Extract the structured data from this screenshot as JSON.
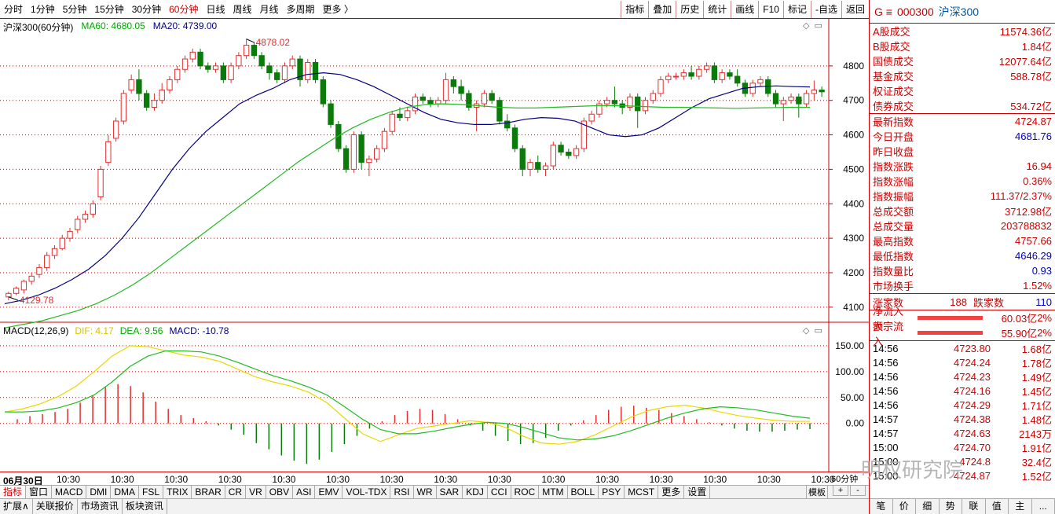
{
  "toolbar": {
    "periods": [
      "分时",
      "1分钟",
      "5分钟",
      "15分钟",
      "30分钟",
      "60分钟",
      "日线",
      "周线",
      "月线",
      "多周期",
      "更多 〉"
    ],
    "active_period": "60分钟",
    "buttons": [
      "指标",
      "叠加",
      "历史",
      "统计",
      "画线",
      "F10",
      "标记",
      "-自选",
      "返回"
    ]
  },
  "legend": {
    "name": "沪深300(60分钟)",
    "ma60": "MA60: 4680.05",
    "ma20": "MA20: 4739.00"
  },
  "macd_legend": {
    "name": "MACD(12,26,9)",
    "dif": "DIF: 4.17",
    "dea": "DEA: 9.56",
    "macd": "MACD: -10.78"
  },
  "annotations": {
    "high": "4878.02",
    "low": "4129.78"
  },
  "y_axis_main": [
    "4800",
    "4700",
    "4600",
    "4500",
    "4400",
    "4300",
    "4200",
    "4100"
  ],
  "y_axis_macd": [
    "150.00",
    "100.00",
    "50.00",
    "0.00"
  ],
  "x_axis": [
    "06月30日",
    "10:30",
    "10:30",
    "10:30",
    "10:30",
    "10:30",
    "10:30",
    "10:30",
    "10:30",
    "10:30",
    "10:30",
    "10:30",
    "10:30",
    "10:30",
    "10:30",
    "10:30"
  ],
  "period_tag": "60分钟",
  "indicator_tabs": [
    "指标",
    "窗口",
    "MACD",
    "DMI",
    "DMA",
    "FSL",
    "TRIX",
    "BRAR",
    "CR",
    "VR",
    "OBV",
    "ASI",
    "EMV",
    "VOL-TDX",
    "RSI",
    "WR",
    "SAR",
    "KDJ",
    "CCI",
    "ROC",
    "MTM",
    "BOLL",
    "PSY",
    "MCST",
    "更多",
    "设置"
  ],
  "bottom_tabs": [
    "扩展∧",
    "关联报价",
    "市场资讯",
    "板块资讯"
  ],
  "board_label": "模板",
  "side": {
    "code": "000300",
    "name": "沪深300",
    "prefix": "G ≡",
    "turnover": [
      {
        "k": "A股成交",
        "v": "11574.36亿"
      },
      {
        "k": "B股成交",
        "v": "1.84亿"
      },
      {
        "k": "国债成交",
        "v": "12077.64亿"
      },
      {
        "k": "基金成交",
        "v": "588.78亿"
      },
      {
        "k": "权证成交",
        "v": ""
      },
      {
        "k": "债券成交",
        "v": "534.72亿"
      }
    ],
    "stats": [
      {
        "k": "最新指数",
        "v": "4724.87",
        "c": "red"
      },
      {
        "k": "今日开盘",
        "v": "4681.76",
        "c": "blue"
      },
      {
        "k": "昨日收盘",
        "v": "",
        "c": "black"
      },
      {
        "k": "指数涨跌",
        "v": "16.94",
        "c": "red"
      },
      {
        "k": "指数涨幅",
        "v": "0.36%",
        "c": "red"
      },
      {
        "k": "指数振幅",
        "v": "111.37/2.37%",
        "c": "red"
      },
      {
        "k": "总成交额",
        "v": "3712.98亿",
        "c": "red"
      },
      {
        "k": "总成交量",
        "v": "203788832",
        "c": "red"
      },
      {
        "k": "最高指数",
        "v": "4757.66",
        "c": "red"
      },
      {
        "k": "最低指数",
        "v": "4646.29",
        "c": "blue"
      },
      {
        "k": "指数量比",
        "v": "0.93",
        "c": "blue"
      },
      {
        "k": "市场换手",
        "v": "1.52%",
        "c": "red"
      }
    ],
    "updown": {
      "up_label": "涨家数",
      "up": "188",
      "down_label": "跌家数",
      "down": "110"
    },
    "flows": [
      {
        "k": "净流入额",
        "v": "60.03亿",
        "p": "2%"
      },
      {
        "k": "大宗流入",
        "v": "55.90亿",
        "p": "2%"
      }
    ],
    "ticks": [
      {
        "t": "14:56",
        "p": "4723.80",
        "q": "1.68亿"
      },
      {
        "t": "14:56",
        "p": "4724.24",
        "q": "1.78亿"
      },
      {
        "t": "14:56",
        "p": "4724.23",
        "q": "1.49亿"
      },
      {
        "t": "14:56",
        "p": "4724.16",
        "q": "1.45亿"
      },
      {
        "t": "14:56",
        "p": "4724.29",
        "q": "1.71亿"
      },
      {
        "t": "14:57",
        "p": "4724.38",
        "q": "1.48亿"
      },
      {
        "t": "14:57",
        "p": "4724.63",
        "q": "2143万"
      },
      {
        "t": "15:00",
        "p": "4724.70",
        "q": "1.91亿"
      },
      {
        "t": "15:00",
        "p": "4724.8",
        "q": "32.4亿"
      },
      {
        "t": "15:00",
        "p": "4724.87",
        "q": "1.52亿"
      }
    ],
    "bottom_buttons": [
      "笔",
      "价",
      "细",
      "势",
      "联",
      "值",
      "主",
      "..."
    ]
  },
  "watermark": "明权研究院",
  "colors": {
    "up": "#e03030",
    "down": "#0a7a0a",
    "ma20": "#000080",
    "ma60": "#22bb22",
    "dif": "#e8d800",
    "dea": "#22bb22",
    "grid": "#c00"
  },
  "chart_data": {
    "type": "candlestick",
    "ylim": [
      4070,
      4900
    ],
    "candles": [
      [
        4129.78,
        4140,
        4120,
        4145
      ],
      [
        4140,
        4155,
        4135,
        4160
      ],
      [
        4150,
        4175,
        4140,
        4180
      ],
      [
        4175,
        4190,
        4165,
        4200
      ],
      [
        4195,
        4215,
        4185,
        4225
      ],
      [
        4215,
        4250,
        4205,
        4260
      ],
      [
        4250,
        4270,
        4240,
        4280
      ],
      [
        4270,
        4300,
        4265,
        4310
      ],
      [
        4300,
        4320,
        4290,
        4330
      ],
      [
        4325,
        4355,
        4315,
        4365
      ],
      [
        4355,
        4370,
        4345,
        4380
      ],
      [
        4370,
        4400,
        4360,
        4410
      ],
      [
        4420,
        4500,
        4410,
        4510
      ],
      [
        4520,
        4580,
        4510,
        4600
      ],
      [
        4590,
        4640,
        4580,
        4650
      ],
      [
        4640,
        4720,
        4630,
        4730
      ],
      [
        4730,
        4760,
        4720,
        4775
      ],
      [
        4760,
        4720,
        4700,
        4790
      ],
      [
        4720,
        4680,
        4670,
        4730
      ],
      [
        4680,
        4700,
        4670,
        4720
      ],
      [
        4700,
        4730,
        4690,
        4750
      ],
      [
        4730,
        4760,
        4720,
        4770
      ],
      [
        4760,
        4790,
        4750,
        4800
      ],
      [
        4790,
        4820,
        4780,
        4830
      ],
      [
        4820,
        4840,
        4810,
        4850
      ],
      [
        4840,
        4800,
        4790,
        4850
      ],
      [
        4800,
        4790,
        4780,
        4810
      ],
      [
        4790,
        4800,
        4780,
        4810
      ],
      [
        4800,
        4760,
        4750,
        4810
      ],
      [
        4760,
        4800,
        4750,
        4810
      ],
      [
        4800,
        4830,
        4790,
        4840
      ],
      [
        4830,
        4860,
        4820,
        4878.02
      ],
      [
        4860,
        4830,
        4820,
        4870
      ],
      [
        4830,
        4800,
        4790,
        4840
      ],
      [
        4800,
        4780,
        4760,
        4810
      ],
      [
        4780,
        4760,
        4750,
        4790
      ],
      [
        4760,
        4800,
        4750,
        4810
      ],
      [
        4800,
        4820,
        4790,
        4830
      ],
      [
        4820,
        4760,
        4740,
        4830
      ],
      [
        4760,
        4810,
        4750,
        4820
      ],
      [
        4810,
        4760,
        4750,
        4820
      ],
      [
        4760,
        4690,
        4680,
        4770
      ],
      [
        4690,
        4630,
        4620,
        4700
      ],
      [
        4630,
        4560,
        4550,
        4640
      ],
      [
        4560,
        4500,
        4490,
        4570
      ],
      [
        4500,
        4600,
        4490,
        4610
      ],
      [
        4600,
        4520,
        4500,
        4610
      ],
      [
        4520,
        4530,
        4480,
        4540
      ],
      [
        4530,
        4560,
        4520,
        4570
      ],
      [
        4560,
        4610,
        4550,
        4620
      ],
      [
        4610,
        4660,
        4600,
        4670
      ],
      [
        4660,
        4650,
        4640,
        4680
      ],
      [
        4650,
        4670,
        4640,
        4680
      ],
      [
        4670,
        4710,
        4660,
        4720
      ],
      [
        4710,
        4700,
        4690,
        4720
      ],
      [
        4700,
        4690,
        4680,
        4710
      ],
      [
        4690,
        4700,
        4680,
        4710
      ],
      [
        4700,
        4760,
        4690,
        4780
      ],
      [
        4760,
        4740,
        4720,
        4770
      ],
      [
        4740,
        4720,
        4700,
        4760
      ],
      [
        4720,
        4680,
        4670,
        4730
      ],
      [
        4680,
        4690,
        4610,
        4700
      ],
      [
        4690,
        4720,
        4680,
        4730
      ],
      [
        4720,
        4700,
        4690,
        4730
      ],
      [
        4700,
        4640,
        4630,
        4710
      ],
      [
        4640,
        4620,
        4610,
        4660
      ],
      [
        4620,
        4560,
        4550,
        4630
      ],
      [
        4560,
        4500,
        4480,
        4570
      ],
      [
        4500,
        4520,
        4480,
        4530
      ],
      [
        4520,
        4500,
        4490,
        4540
      ],
      [
        4500,
        4510,
        4480,
        4520
      ],
      [
        4510,
        4570,
        4500,
        4580
      ],
      [
        4570,
        4550,
        4540,
        4580
      ],
      [
        4550,
        4540,
        4530,
        4560
      ],
      [
        4540,
        4560,
        4530,
        4570
      ],
      [
        4560,
        4640,
        4550,
        4650
      ],
      [
        4640,
        4660,
        4630,
        4670
      ],
      [
        4660,
        4690,
        4650,
        4700
      ],
      [
        4690,
        4700,
        4680,
        4710
      ],
      [
        4700,
        4690,
        4680,
        4740
      ],
      [
        4690,
        4680,
        4660,
        4700
      ],
      [
        4680,
        4710,
        4670,
        4720
      ],
      [
        4710,
        4670,
        4620,
        4720
      ],
      [
        4670,
        4700,
        4660,
        4710
      ],
      [
        4700,
        4720,
        4690,
        4730
      ],
      [
        4720,
        4760,
        4710,
        4770
      ],
      [
        4760,
        4770,
        4750,
        4780
      ],
      [
        4770,
        4770,
        4760,
        4780
      ],
      [
        4770,
        4780,
        4760,
        4790
      ],
      [
        4780,
        4770,
        4760,
        4800
      ],
      [
        4770,
        4790,
        4760,
        4800
      ],
      [
        4790,
        4800,
        4780,
        4810
      ],
      [
        4800,
        4760,
        4750,
        4810
      ],
      [
        4760,
        4780,
        4750,
        4790
      ],
      [
        4780,
        4770,
        4760,
        4790
      ],
      [
        4770,
        4750,
        4740,
        4790
      ],
      [
        4750,
        4720,
        4710,
        4760
      ],
      [
        4720,
        4750,
        4710,
        4760
      ],
      [
        4750,
        4760,
        4740,
        4770
      ],
      [
        4760,
        4720,
        4710,
        4770
      ],
      [
        4720,
        4690,
        4680,
        4730
      ],
      [
        4690,
        4700,
        4640,
        4710
      ],
      [
        4700,
        4710,
        4690,
        4720
      ],
      [
        4710,
        4690,
        4650,
        4720
      ],
      [
        4690,
        4720,
        4680,
        4730
      ],
      [
        4720,
        4730,
        4700,
        4757.66
      ],
      [
        4730,
        4724.87,
        4710,
        4740
      ]
    ],
    "ma20": [
      4110,
      4120,
      4135,
      4155,
      4180,
      4210,
      4250,
      4300,
      4360,
      4430,
      4500,
      4560,
      4610,
      4650,
      4690,
      4715,
      4735,
      4760,
      4775,
      4780,
      4775,
      4760,
      4740,
      4715,
      4690,
      4665,
      4645,
      4635,
      4630,
      4630,
      4635,
      4645,
      4650,
      4648,
      4640,
      4620,
      4600,
      4595,
      4600,
      4620,
      4650,
      4680,
      4705,
      4720,
      4735,
      4740,
      4742,
      4740,
      4739
    ],
    "ma60": [
      4040,
      4050,
      4060,
      4075,
      4090,
      4110,
      4135,
      4165,
      4200,
      4240,
      4280,
      4320,
      4360,
      4400,
      4440,
      4480,
      4520,
      4555,
      4590,
      4620,
      4645,
      4665,
      4680,
      4688,
      4690,
      4688,
      4684,
      4680,
      4678,
      4678,
      4680,
      4682,
      4684,
      4685,
      4684,
      4682,
      4680,
      4680,
      4679,
      4678,
      4677,
      4678,
      4679,
      4680,
      4680
    ],
    "dif": [
      22,
      28,
      38,
      52,
      72,
      100,
      130,
      150,
      148,
      140,
      132,
      128,
      120,
      105,
      90,
      80,
      72,
      60,
      40,
      10,
      -20,
      -35,
      -22,
      -10,
      -5,
      0,
      5,
      2,
      -8,
      -25,
      -38,
      -40,
      -35,
      -22,
      -5,
      12,
      25,
      32,
      35,
      30,
      22,
      15,
      10,
      6,
      4,
      4
    ],
    "dea": [
      22,
      22,
      24,
      30,
      40,
      55,
      80,
      110,
      130,
      140,
      140,
      138,
      130,
      118,
      105,
      92,
      82,
      70,
      55,
      32,
      8,
      -12,
      -20,
      -20,
      -15,
      -8,
      -2,
      2,
      0,
      -8,
      -18,
      -28,
      -32,
      -30,
      -24,
      -14,
      -2,
      10,
      20,
      28,
      32,
      30,
      26,
      20,
      14,
      10
    ],
    "macd": [
      0,
      8,
      14,
      18,
      22,
      28,
      40,
      54,
      70,
      76,
      72,
      60,
      42,
      28,
      16,
      10,
      4,
      -4,
      -12,
      -22,
      -38,
      -50,
      -62,
      -72,
      -78,
      -70,
      -55,
      -40,
      -24,
      -10,
      4,
      16,
      24,
      28,
      26,
      18,
      8,
      -4,
      -14,
      -24,
      -34,
      -40,
      -38,
      -28,
      -14,
      -4,
      6,
      16,
      26,
      32,
      34,
      30,
      26,
      20,
      14,
      8,
      2,
      -4,
      -10,
      -14,
      -16,
      -16,
      -14,
      -12,
      -11
    ]
  }
}
